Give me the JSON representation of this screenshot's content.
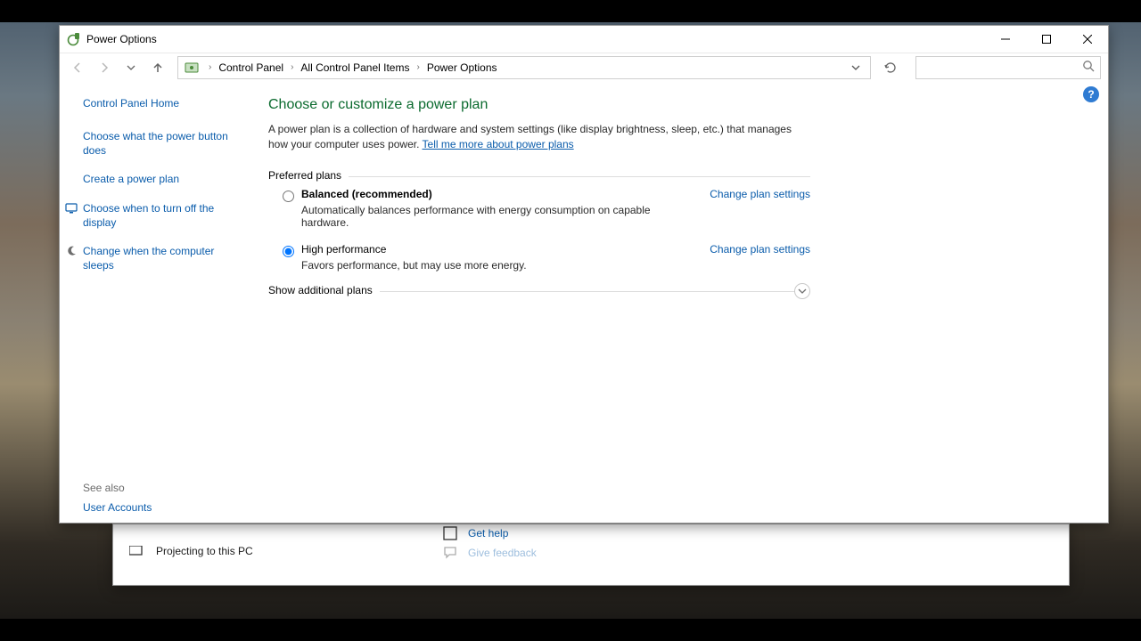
{
  "window": {
    "title": "Power Options",
    "breadcrumb": {
      "root": "Control Panel",
      "mid": "All Control Panel Items",
      "leaf": "Power Options"
    },
    "search_placeholder": ""
  },
  "sidebar": {
    "home": "Control Panel Home",
    "links": [
      {
        "label": "Choose what the power button does"
      },
      {
        "label": "Create a power plan"
      },
      {
        "label": "Choose when to turn off the display"
      },
      {
        "label": "Change when the computer sleeps"
      }
    ],
    "see_also_label": "See also",
    "see_also_links": [
      {
        "label": "User Accounts"
      }
    ]
  },
  "main": {
    "title": "Choose or customize a power plan",
    "description_prefix": "A power plan is a collection of hardware and system settings (like display brightness, sleep, etc.) that manages how your computer uses power. ",
    "description_link": "Tell me more about power plans",
    "preferred_label": "Preferred plans",
    "plans": [
      {
        "name": "Balanced (recommended)",
        "bold": true,
        "selected": false,
        "desc": "Automatically balances performance with energy consumption on capable hardware.",
        "change": "Change plan settings"
      },
      {
        "name": "High performance",
        "bold": false,
        "selected": true,
        "desc": "Favors performance, but may use more energy.",
        "change": "Change plan settings"
      }
    ],
    "additional_label": "Show additional plans"
  },
  "bg_window": {
    "left_item": "Projecting to this PC",
    "right_links": [
      {
        "label": "Get help"
      },
      {
        "label": "Give feedback"
      }
    ]
  },
  "colors": {
    "link": "#0a5cab",
    "title_green": "#0a6a2e"
  }
}
